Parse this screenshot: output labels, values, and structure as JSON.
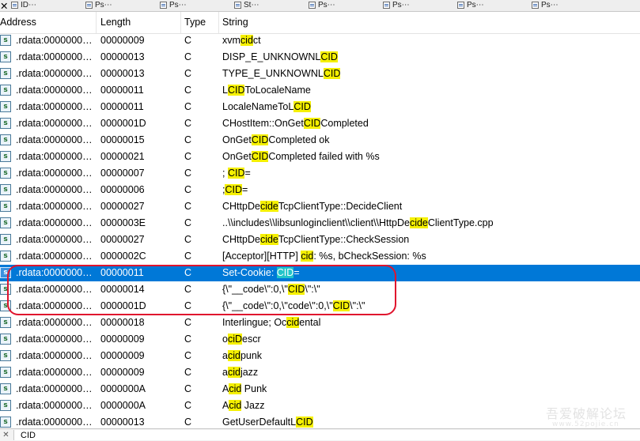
{
  "tabs": [
    {
      "label": "ID⋯"
    },
    {
      "label": "Ps⋯"
    },
    {
      "label": "Ps⋯"
    },
    {
      "label": "St⋯"
    },
    {
      "label": "Ps⋯"
    },
    {
      "label": "Ps⋯"
    },
    {
      "label": "Ps⋯"
    },
    {
      "label": "Ps⋯"
    }
  ],
  "columns": {
    "address": "Address",
    "length": "Length",
    "type": "Type",
    "string": "String"
  },
  "rows": [
    {
      "icon": "s",
      "address": ".rdata:0000000…",
      "length": "00000009",
      "type": "C",
      "string": [
        {
          "t": "xvm"
        },
        {
          "t": "cid",
          "h": 1
        },
        {
          "t": "ct"
        }
      ]
    },
    {
      "icon": "s",
      "address": ".rdata:0000000…",
      "length": "00000013",
      "type": "C",
      "string": [
        {
          "t": "DISP_E_UNKNOWNL"
        },
        {
          "t": "CID",
          "h": 1
        }
      ]
    },
    {
      "icon": "s",
      "address": ".rdata:0000000…",
      "length": "00000013",
      "type": "C",
      "string": [
        {
          "t": "TYPE_E_UNKNOWNL"
        },
        {
          "t": "CID",
          "h": 1
        }
      ]
    },
    {
      "icon": "s",
      "address": ".rdata:0000000…",
      "length": "00000011",
      "type": "C",
      "string": [
        {
          "t": "L"
        },
        {
          "t": "CID",
          "h": 1
        },
        {
          "t": "ToLocaleName"
        }
      ]
    },
    {
      "icon": "s",
      "address": ".rdata:0000000…",
      "length": "00000011",
      "type": "C",
      "string": [
        {
          "t": "LocaleNameToL"
        },
        {
          "t": "CID",
          "h": 1
        }
      ]
    },
    {
      "icon": "s",
      "address": ".rdata:0000000…",
      "length": "0000001D",
      "type": "C",
      "string": [
        {
          "t": "CHostItem::OnGet"
        },
        {
          "t": "CID",
          "h": 1
        },
        {
          "t": "Completed"
        }
      ]
    },
    {
      "icon": "s",
      "address": ".rdata:0000000…",
      "length": "00000015",
      "type": "C",
      "string": [
        {
          "t": "OnGet"
        },
        {
          "t": "CID",
          "h": 1
        },
        {
          "t": "Completed ok"
        }
      ]
    },
    {
      "icon": "s",
      "address": ".rdata:0000000…",
      "length": "00000021",
      "type": "C",
      "string": [
        {
          "t": "OnGet"
        },
        {
          "t": "CID",
          "h": 1
        },
        {
          "t": "Completed failed with %s"
        }
      ]
    },
    {
      "icon": "s",
      "address": ".rdata:0000000…",
      "length": "00000007",
      "type": "C",
      "string": [
        {
          "t": "; "
        },
        {
          "t": "CID",
          "h": 1
        },
        {
          "t": "="
        }
      ]
    },
    {
      "icon": "s",
      "address": ".rdata:0000000…",
      "length": "00000006",
      "type": "C",
      "string": [
        {
          "t": ";"
        },
        {
          "t": "CID",
          "h": 1
        },
        {
          "t": "="
        }
      ]
    },
    {
      "icon": "s",
      "address": ".rdata:0000000…",
      "length": "00000027",
      "type": "C",
      "string": [
        {
          "t": "CHttpDe"
        },
        {
          "t": "cide",
          "h": 1
        },
        {
          "t": "TcpClientType::DecideClient"
        }
      ]
    },
    {
      "icon": "s",
      "address": ".rdata:0000000…",
      "length": "0000003E",
      "type": "C",
      "string": [
        {
          "t": "..\\\\includes\\\\libsunloginclient\\\\client\\\\HttpDe"
        },
        {
          "t": "cide",
          "h": 1
        },
        {
          "t": "ClientType.cpp"
        }
      ]
    },
    {
      "icon": "s",
      "address": ".rdata:0000000…",
      "length": "00000027",
      "type": "C",
      "string": [
        {
          "t": "CHttpDe"
        },
        {
          "t": "cide",
          "h": 1
        },
        {
          "t": "TcpClientType::CheckSession"
        }
      ]
    },
    {
      "icon": "s",
      "address": ".rdata:0000000…",
      "length": "0000002C",
      "type": "C",
      "string": [
        {
          "t": "[Acceptor][HTTP] "
        },
        {
          "t": "cid",
          "h": 1
        },
        {
          "t": ": %s, bCheckSession: %s"
        }
      ]
    },
    {
      "icon": "s",
      "address": ".rdata:0000000…",
      "length": "00000011",
      "type": "C",
      "selected": true,
      "string": [
        {
          "t": "Set-Cookie: "
        },
        {
          "t": "CID",
          "h": 1
        },
        {
          "t": "="
        }
      ]
    },
    {
      "icon": "s",
      "address": ".rdata:0000000…",
      "length": "00000014",
      "type": "C",
      "string": [
        {
          "t": "{\\\"__code\\\":0,\\\""
        },
        {
          "t": "CID",
          "h": 1
        },
        {
          "t": "\\\":\\\""
        }
      ]
    },
    {
      "icon": "s",
      "address": ".rdata:0000000…",
      "length": "0000001D",
      "type": "C",
      "string": [
        {
          "t": "{\\\"__code\\\":0,\\\"code\\\":0,\\\""
        },
        {
          "t": "CID",
          "h": 1
        },
        {
          "t": "\\\":\\\""
        }
      ]
    },
    {
      "icon": "s",
      "address": ".rdata:0000000…",
      "length": "00000018",
      "type": "C",
      "string": [
        {
          "t": "Interlingue; Oc"
        },
        {
          "t": "cid",
          "h": 1
        },
        {
          "t": "ental"
        }
      ]
    },
    {
      "icon": "s",
      "address": ".rdata:0000000…",
      "length": "00000009",
      "type": "C",
      "string": [
        {
          "t": "o"
        },
        {
          "t": "ciD",
          "h": 1
        },
        {
          "t": "escr"
        }
      ]
    },
    {
      "icon": "s",
      "address": ".rdata:0000000…",
      "length": "00000009",
      "type": "C",
      "string": [
        {
          "t": "a"
        },
        {
          "t": "cid",
          "h": 1
        },
        {
          "t": "punk"
        }
      ]
    },
    {
      "icon": "s",
      "address": ".rdata:0000000…",
      "length": "00000009",
      "type": "C",
      "string": [
        {
          "t": "a"
        },
        {
          "t": "cid",
          "h": 1
        },
        {
          "t": "jazz"
        }
      ]
    },
    {
      "icon": "s",
      "address": ".rdata:0000000…",
      "length": "0000000A",
      "type": "C",
      "string": [
        {
          "t": "A"
        },
        {
          "t": "cid",
          "h": 1
        },
        {
          "t": " Punk"
        }
      ]
    },
    {
      "icon": "s",
      "address": ".rdata:0000000…",
      "length": "0000000A",
      "type": "C",
      "string": [
        {
          "t": "A"
        },
        {
          "t": "cid",
          "h": 1
        },
        {
          "t": " Jazz"
        }
      ]
    },
    {
      "icon": "s",
      "address": ".rdata:0000000…",
      "length": "00000013",
      "type": "C",
      "string": [
        {
          "t": "GetUserDefaultL"
        },
        {
          "t": "CID",
          "h": 1
        }
      ]
    }
  ],
  "search": {
    "value": "CID"
  },
  "watermark": {
    "text": "吾爱破解论坛",
    "sub": "www.52pojie.cn"
  },
  "colors": {
    "highlight": "#f5f000",
    "selected_row": "#0078d7",
    "selected_highlight": "#23c4c9",
    "annotation": "#e0142e"
  }
}
